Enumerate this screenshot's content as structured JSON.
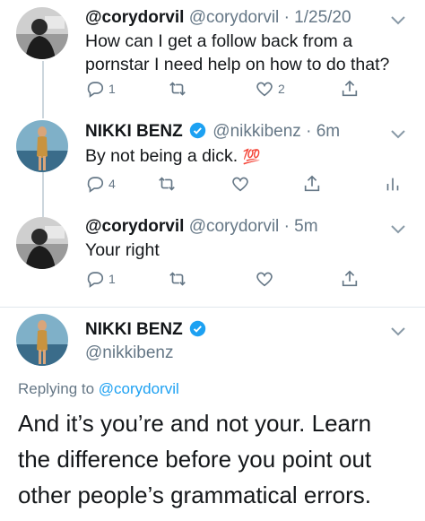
{
  "colors": {
    "accent": "#1da1f2",
    "muted": "#657786",
    "text": "#14171a"
  },
  "tweets": [
    {
      "name": "@corydorvil",
      "handle": "@corydorvil",
      "time": "1/25/20",
      "text_line1": "How can I  get a follow back from a",
      "text_line2": "pornstar I need help on how to do that?",
      "reply_count": "1",
      "like_count": "2"
    },
    {
      "name": "NIKKI BENZ",
      "handle": "@nikkibenz",
      "time": "6m",
      "text": "By not being a dick.",
      "emoji": "💯",
      "reply_count": "4"
    },
    {
      "name": "@corydorvil",
      "handle": "@corydorvil",
      "time": "5m",
      "text": "Your right",
      "reply_count": "1"
    }
  ],
  "focused": {
    "name": "NIKKI BENZ",
    "handle": "@nikkibenz",
    "replying_prefix": "Replying to",
    "replying_handle": "@corydorvil",
    "text_line1": "And it’s you’re and not your. Learn",
    "text_line2": "the difference before you point out",
    "text_line3": "other people’s grammatical errors."
  },
  "icons": [
    "reply-icon",
    "retweet-icon",
    "like-icon",
    "share-icon",
    "analytics-icon",
    "verified-icon",
    "chevron-down-icon"
  ]
}
